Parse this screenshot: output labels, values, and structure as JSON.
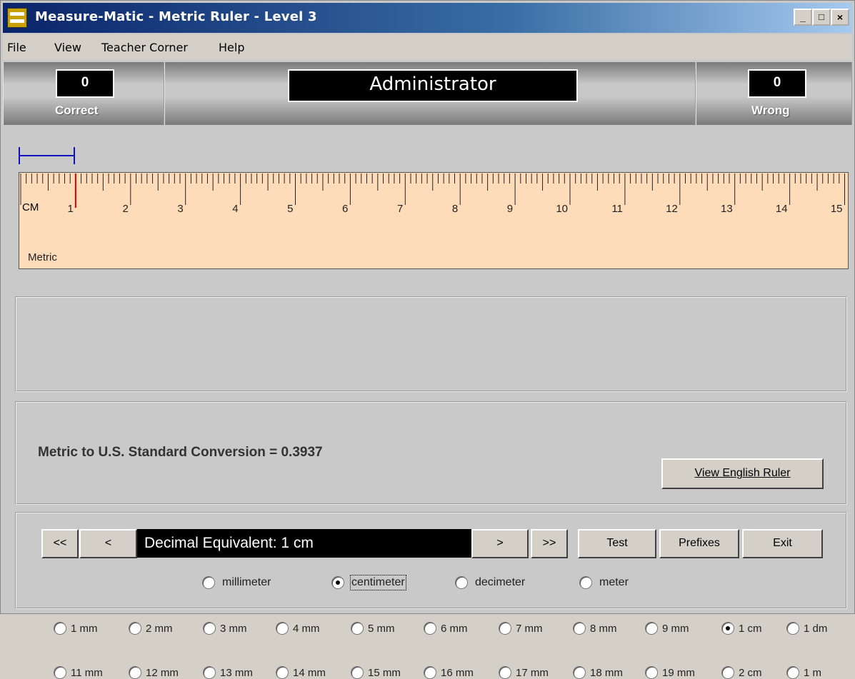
{
  "window": {
    "title": "Measure-Matic - Metric Ruler - Level 3",
    "controls": [
      "_",
      "□",
      "×"
    ]
  },
  "menu": [
    "File",
    "View",
    "Teacher Corner",
    "Help"
  ],
  "score": {
    "correct_value": "0",
    "correct_label": "Correct",
    "user": "Administrator",
    "wrong_value": "0",
    "wrong_label": "Wrong"
  },
  "ruler": {
    "unit_label": "CM",
    "numbers": [
      "1",
      "2",
      "3",
      "4",
      "5",
      "6",
      "7",
      "8",
      "9",
      "10",
      "11",
      "12",
      "13",
      "14",
      "15"
    ],
    "panel_label": "Metric",
    "selected_length_cm": 1,
    "marker_color": "#e00000",
    "measure_color": "#1010c0",
    "background": "#ffdcb9"
  },
  "measure_options": {
    "row1": [
      "1 mm",
      "2 mm",
      "3 mm",
      "4 mm",
      "5 mm",
      "6 mm",
      "7 mm",
      "8 mm",
      "9 mm",
      "1 cm",
      "1 dm"
    ],
    "row2": [
      "11 mm",
      "12 mm",
      "13 mm",
      "14 mm",
      "15 mm",
      "16 mm",
      "17 mm",
      "18 mm",
      "19 mm",
      "2 cm",
      "1 m"
    ],
    "selected": "1 cm"
  },
  "conversion": {
    "text": "Metric to U.S. Standard Conversion = 0.3937",
    "view_english_button": "View English Ruler"
  },
  "nav": {
    "first": "<<",
    "prev": "<",
    "display": "Decimal Equivalent: 1 cm",
    "next": ">",
    "last": ">>",
    "test_button": "Test",
    "prefixes_button": "Prefixes",
    "exit_button": "Exit"
  },
  "units": {
    "options": [
      "millimeter",
      "centimeter",
      "decimeter",
      "meter"
    ],
    "selected": "centimeter"
  }
}
